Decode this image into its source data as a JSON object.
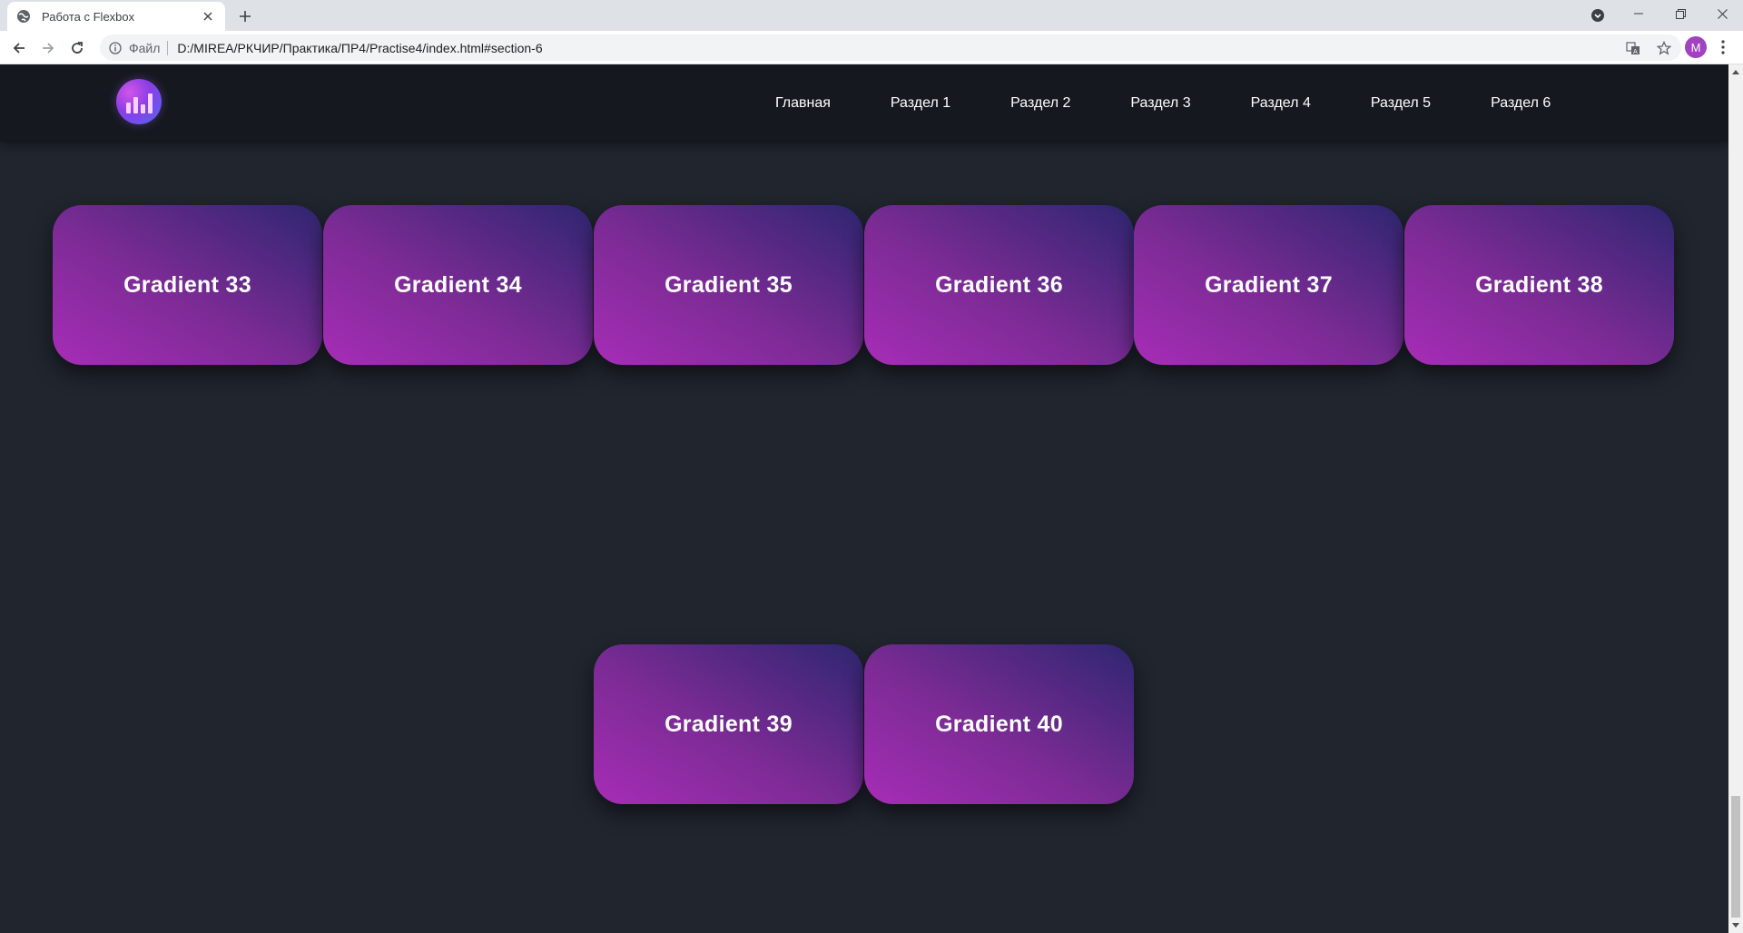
{
  "browser": {
    "tab_title": "Работа с Flexbox",
    "scheme_label": "Файл",
    "url": "D:/MIREA/РКЧИР/Практика/ПР4/Practise4/index.html#section-6",
    "profile_initial": "M"
  },
  "site": {
    "nav": [
      "Главная",
      "Раздел 1",
      "Раздел 2",
      "Раздел 3",
      "Раздел 4",
      "Раздел 5",
      "Раздел 6"
    ]
  },
  "cards": {
    "row1": [
      "Gradient 33",
      "Gradient 34",
      "Gradient 35",
      "Gradient 36",
      "Gradient 37",
      "Gradient 38"
    ],
    "row2": [
      "Gradient 39",
      "Gradient 40"
    ]
  },
  "colors": {
    "page_bg": "#20252e",
    "header_bg": "#15191f",
    "gradient_start": "#a72db7",
    "gradient_end": "#2e2670"
  }
}
